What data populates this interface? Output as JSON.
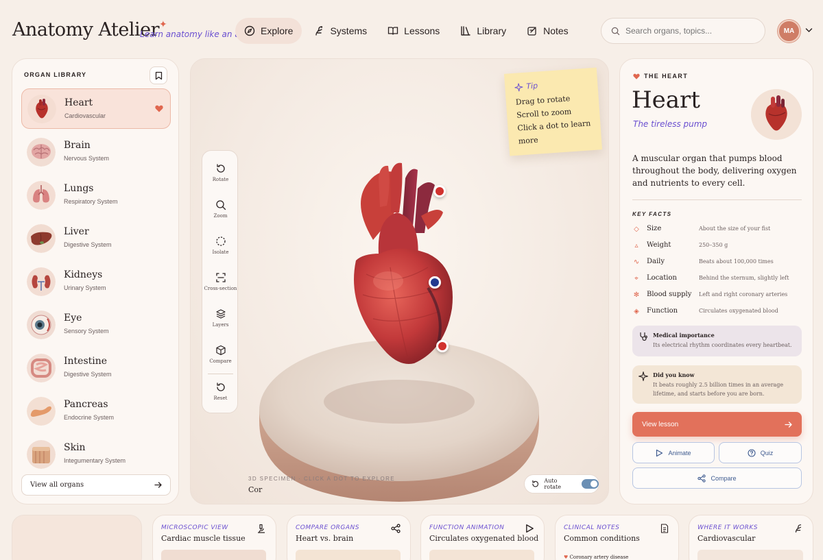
{
  "app": {
    "brand": "Anatomy Atelier",
    "tagline": "Learn anatomy like an artist",
    "avatar_initials": "MA"
  },
  "nav": [
    {
      "label": "Explore",
      "icon": "compass-icon",
      "active": true
    },
    {
      "label": "Systems",
      "icon": "systems-icon"
    },
    {
      "label": "Lessons",
      "icon": "book-icon"
    },
    {
      "label": "Library",
      "icon": "library-icon"
    },
    {
      "label": "Notes",
      "icon": "notes-icon"
    }
  ],
  "search": {
    "placeholder": "Search organs, topics..."
  },
  "library": {
    "title": "ORGAN LIBRARY",
    "view_all": "View all organs",
    "organs": [
      {
        "name": "Heart",
        "system": "Cardiovascular",
        "selected": true,
        "favorite": true
      },
      {
        "name": "Brain",
        "system": "Nervous System"
      },
      {
        "name": "Lungs",
        "system": "Respiratory System"
      },
      {
        "name": "Liver",
        "system": "Digestive System"
      },
      {
        "name": "Kidneys",
        "system": "Urinary System"
      },
      {
        "name": "Eye",
        "system": "Sensory System"
      },
      {
        "name": "Intestine",
        "system": "Digestive System"
      },
      {
        "name": "Pancreas",
        "system": "Endocrine System"
      },
      {
        "name": "Skin",
        "system": "Integumentary System"
      }
    ]
  },
  "viewer": {
    "tools": [
      "Rotate",
      "Zoom",
      "Isolate",
      "Cross-section",
      "Layers",
      "Compare",
      "Reset"
    ],
    "tip": {
      "title": "Tip",
      "lines": [
        "Drag to rotate",
        "Scroll to zoom",
        "Click a dot to learn",
        "more"
      ]
    },
    "caption_kicker": "3D SPECIMEN · CLICK A DOT TO EXPLORE",
    "caption_value": "Cor",
    "auto_rotate_label": "Auto rotate",
    "auto_rotate_on": true
  },
  "detail": {
    "kicker": "THE HEART",
    "title": "Heart",
    "subtitle": "The tireless pump",
    "description": "A muscular organ that pumps blood throughout the body, delivering oxygen and nutrients to every cell.",
    "facts_title": "KEY FACTS",
    "facts": [
      {
        "label": "Size",
        "value": "About the size of your fist",
        "icon": "diamond-icon"
      },
      {
        "label": "Weight",
        "value": "250–350 g",
        "icon": "weight-icon"
      },
      {
        "label": "Daily",
        "value": "Beats about 100,000 times",
        "icon": "pulse-icon"
      },
      {
        "label": "Location",
        "value": "Behind the sternum, slightly left",
        "icon": "crosshair-icon"
      },
      {
        "label": "Blood supply",
        "value": "Left and right coronary arteries",
        "icon": "asterisk-icon"
      },
      {
        "label": "Function",
        "value": "Circulates oxygenated blood",
        "icon": "gem-icon"
      }
    ],
    "medical": {
      "title": "Medical importance",
      "text": "Its electrical rhythm coordinates every heartbeat."
    },
    "did_you_know": {
      "title": "Did you know",
      "text": "It beats roughly 2.5 billion times in an average lifetime, and starts before you are born."
    },
    "view_lesson": "View lesson",
    "animate": "Animate",
    "quiz": "Quiz",
    "compare": "Compare"
  },
  "bottom_cards": [
    {
      "kicker": "MICROSCOPIC VIEW",
      "title": "Cardiac muscle tissue",
      "icon": "microscope-icon"
    },
    {
      "kicker": "COMPARE ORGANS",
      "title": "Heart vs. brain",
      "icon": "share-icon"
    },
    {
      "kicker": "FUNCTION ANIMATION",
      "title": "Circulates oxygenated blood",
      "icon": "play-icon"
    },
    {
      "kicker": "CLINICAL NOTES",
      "title": "Common conditions",
      "icon": "document-icon",
      "item": "Coronary artery disease"
    },
    {
      "kicker": "WHERE IT WORKS",
      "title": "Cardiovascular",
      "icon": "body-icon"
    }
  ],
  "colors": {
    "accent": "#e2715b",
    "purple": "#6a4fd0",
    "background": "#f7efe8",
    "card": "#fcf7f3",
    "blue": "#3e5a8f"
  }
}
